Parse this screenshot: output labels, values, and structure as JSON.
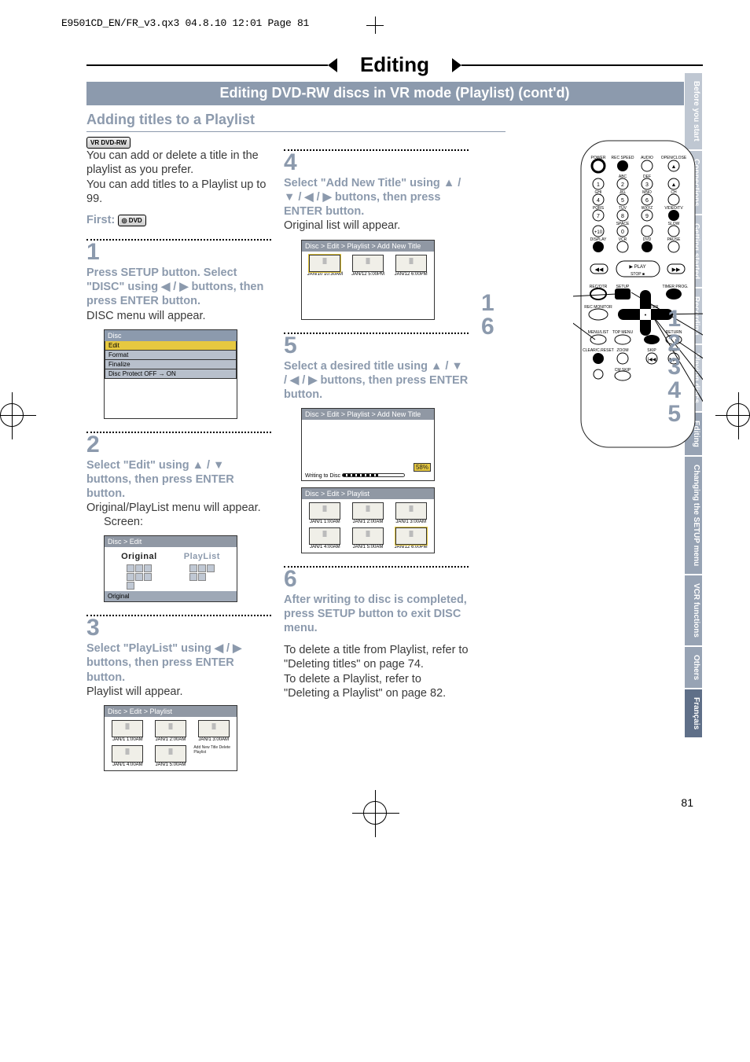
{
  "print_header": "E9501CD_EN/FR_v3.qx3  04.8.10  12:01  Page 81",
  "banner_title": "Editing",
  "sub_banner": "Editing DVD-RW discs in VR mode (Playlist) (cont'd)",
  "section_heading": "Adding titles to a Playlist",
  "badge": "VR DVD-RW",
  "intro_p1": "You can add or delete a title in the playlist as you prefer.",
  "intro_p2": "You can add titles to a Playlist up to 99.",
  "first_label": "First:",
  "steps": {
    "s1": {
      "num": "1",
      "title": "Press SETUP button. Select \"DISC\" using ◀ / ▶ buttons, then press ENTER button.",
      "body": "DISC menu will appear."
    },
    "s2": {
      "num": "2",
      "title": "Select \"Edit\" using ▲ / ▼ buttons, then press ENTER button.",
      "body": "Original/PlayList menu will appear.",
      "screen_label": "Screen:"
    },
    "s3": {
      "num": "3",
      "title": "Select \"PlayList\" using ◀ / ▶ buttons, then press ENTER button.",
      "body": "Playlist will appear."
    },
    "s4": {
      "num": "4",
      "title": "Select \"Add New Title\" using ▲ / ▼ / ◀ / ▶ buttons, then press ENTER button.",
      "body": "Original list will appear."
    },
    "s5": {
      "num": "5",
      "title": "Select a desired title using ▲ / ▼ / ◀ / ▶ buttons, then press ENTER button."
    },
    "s6": {
      "num": "6",
      "title": "After writing to disc is completed, press SETUP button to exit DISC menu.",
      "body1": "To delete a title from Playlist, refer to \"Deleting titles\" on page 74.",
      "body2": "To delete a Playlist, refer to \"Deleting a Playlist\" on page 82."
    }
  },
  "disc_menu": {
    "title": "Disc",
    "items": [
      "Edit",
      "Format",
      "Finalize",
      "Disc Protect OFF → ON"
    ]
  },
  "edit_screen": {
    "crumb": "Disc > Edit",
    "left": "Original",
    "right": "PlayList",
    "status": "Original"
  },
  "playlist_screen": {
    "crumb": "Disc > Edit > Playlist",
    "cells": [
      "JAN/1  1:00AM",
      "JAN/1  2:00AM",
      "JAN/1  3:00AM",
      "JAN/1  4:00AM",
      "JAN/1  5:00AM"
    ],
    "menu_items": "Add  New\nTitle\nDelete\nPlaylist"
  },
  "addnew_screen": {
    "crumb": "Disc > Edit > Playlist > Add New Title",
    "cells": [
      "JAN/10 10:30AM",
      "JAN/12  5:00PM",
      "JAN/12  6:00PM"
    ]
  },
  "write_screen": {
    "crumb": "Disc > Edit > Playlist > Add New Title",
    "percent": "58%",
    "label": "Writing to Disc"
  },
  "playlist_after": {
    "crumb": "Disc > Edit > Playlist",
    "cells": [
      "JAN/1  1:00AM",
      "JAN/1  2:00AM",
      "JAN/1  3:00AM",
      "JAN/1  4:00AM",
      "JAN/1  5:00AM",
      "JAN/12  6:00PM"
    ]
  },
  "remote_callouts": {
    "left_top": "1",
    "left_bottom": "6",
    "right": [
      "1",
      "2",
      "3",
      "4",
      "5"
    ]
  },
  "remote_labels": {
    "row0": [
      "POWER",
      "REC SPEED",
      "AUDIO",
      "OPEN/CLOSE"
    ],
    "row1_top": [
      "",
      "ABC",
      "DEF",
      ""
    ],
    "row1": [
      "1",
      "2",
      "3",
      "▲"
    ],
    "row2_top": [
      "GHI",
      "JKL",
      "MNO",
      "CH"
    ],
    "row2": [
      "4",
      "5",
      "6",
      ""
    ],
    "row3_top": [
      "PQRS",
      "TUV",
      "WXYZ",
      "VIDEO/TV"
    ],
    "row3": [
      "7",
      "8",
      "9",
      "●"
    ],
    "row4_top": [
      "",
      "SPACE",
      "",
      "SLOW"
    ],
    "row4": [
      "+10",
      "0",
      "DVD",
      "❚▶"
    ],
    "row5_top": [
      "DISPLAY",
      "VCR",
      "DVD",
      "PAUSE"
    ],
    "row5": [
      "●",
      "●",
      "●",
      "❚❚"
    ],
    "play": "▶ PLAY",
    "stop": "STOP ■",
    "row6_top": [
      "REC/OTR",
      "SETUP",
      "",
      "TIMER PROG."
    ],
    "row7_top": [
      "REC MONITOR",
      "",
      "ENTER",
      ""
    ],
    "row8_top": [
      "MENU/LIST",
      "TOP MENU",
      "",
      "RETURN"
    ],
    "row9_top": [
      "CLEAR/C.RESET",
      "ZOOM",
      "SKIP",
      "SKIP"
    ],
    "row10_top": [
      "",
      "CM SKIP",
      "",
      ""
    ]
  },
  "side_tabs": [
    {
      "label": "Before you start",
      "shade": "grey"
    },
    {
      "label": "Connections",
      "shade": "grey"
    },
    {
      "label": "Getting started",
      "shade": "grey"
    },
    {
      "label": "Recording",
      "shade": "grey"
    },
    {
      "label": "Playing discs",
      "shade": "grey"
    },
    {
      "label": "Editing",
      "shade": "mid"
    },
    {
      "label": "Changing the SETUP menu",
      "shade": "mid"
    },
    {
      "label": "VCR functions",
      "shade": "mid"
    },
    {
      "label": "Others",
      "shade": "mid"
    },
    {
      "label": "Français",
      "shade": "dark"
    }
  ],
  "page_number": "81"
}
